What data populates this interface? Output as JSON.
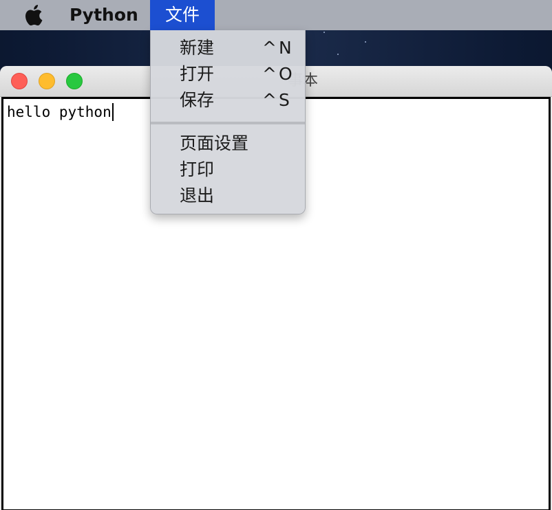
{
  "menubar": {
    "apple_icon": "apple-logo-icon",
    "app_name": "Python",
    "active_menu": "文件",
    "colors": {
      "bar": "#a9adb6",
      "active": "#1c4fd1"
    }
  },
  "file_menu": {
    "items": [
      {
        "label": "新建",
        "shortcut": "^N"
      },
      {
        "label": "打开",
        "shortcut": "^O"
      },
      {
        "label": "保存",
        "shortcut": "^S"
      },
      {
        "label": "页面设置",
        "shortcut": ""
      },
      {
        "label": "打印",
        "shortcut": ""
      },
      {
        "label": "退出",
        "shortcut": ""
      }
    ]
  },
  "window": {
    "title_visible": "事本",
    "buttons": [
      "close",
      "minimize",
      "zoom"
    ]
  },
  "editor": {
    "content": "hello python"
  }
}
